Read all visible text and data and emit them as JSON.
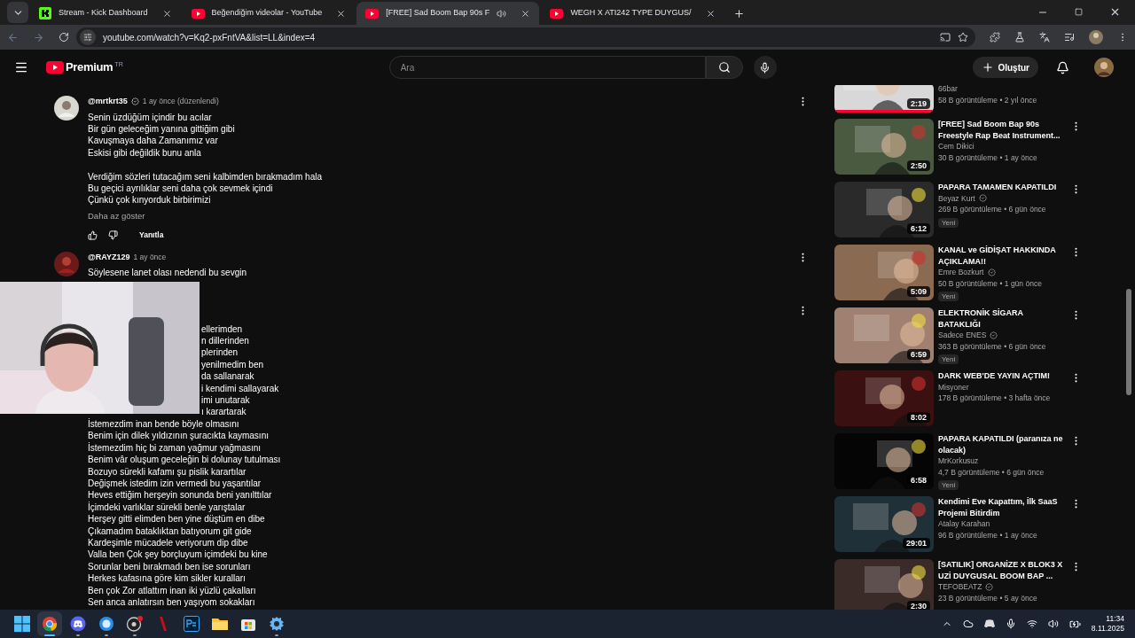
{
  "browser": {
    "tabs": [
      {
        "kind": "kick",
        "label": "Stream - Kick Dashboard",
        "selected": false,
        "playing": false
      },
      {
        "kind": "youtube",
        "label": "Beğendiğim videolar - YouTube",
        "selected": false,
        "playing": false
      },
      {
        "kind": "youtube",
        "label": "[FREE] Sad Boom Bap 90s F",
        "selected": true,
        "playing": true
      },
      {
        "kind": "youtube",
        "label": "WEGH X ATI242 TYPE DUYGUS/",
        "selected": false,
        "playing": false
      }
    ],
    "url": "youtube.com/watch?v=Kq2-pxFntVA&list=LL&index=4"
  },
  "header": {
    "logo": "Premium",
    "region": "TR",
    "search": {
      "placeholder": "Ara"
    },
    "create": "Oluştur"
  },
  "comments": [
    {
      "author": "@mrtkrt35",
      "verified": true,
      "time": "1 ay önce (düzenlendi)",
      "paragraphs": [
        [
          "Senin üzdüğüm içindir bu acılar",
          "Bir gün geleceğim yanına gittiğim gibi",
          "Kavuşmaya daha Zamanımız var",
          "Eskisi gibi değildik bunu anla"
        ],
        [
          "Verdiğim sözleri tutacağım seni kalbimden bırakmadım hala",
          "Bu geçici ayrılıklar seni daha çok sevmek içindi",
          "Çünkü çok kınyorduk birbirimizi"
        ]
      ],
      "toggle": "Daha az göster",
      "reply": "Yanıtla"
    },
    {
      "author": "@RAYZ129",
      "verified": false,
      "time": "1 ay önce",
      "paragraphs": [
        [
          "Söylesene lanet olası nedendi bu sevgin"
        ]
      ],
      "hidden_lines": [
        "ellerimden",
        "n dillerinden",
        "plerinden",
        "yenilmedim ben",
        "da sallanarak",
        "i kendimi sallayarak",
        "imi unutarak",
        "ı karartarak"
      ],
      "more_lines": [
        "İstemezdim inan bende böyle olmasını",
        "Benim için dilek yıldızının şuracıkta kaymasını",
        "İstemezdim hiç bi zaman yağmur yağmasını",
        "Benim vâr oluşum geceleğin bi dolunay tutulması",
        "Bozuyo sürekli kafamı şu pislik karartılar",
        "Değişmek istedim izin vermedi bu yaşantılar",
        "Heves ettiğim herşeyin sonunda beni yanılttılar",
        "İçimdeki varlıklar sürekli benle yarıştalar",
        "Herşey gitti elimden ben yine düştüm en dibe",
        "Çıkamadım bataklıktan batıyorum git gide",
        "Kardeşimle mücadele veriyorum dip dibe",
        "Valla ben Çok şey borçluyum içimdeki bu kine",
        "Sorunlar beni bırakmadı ben ise sorunları",
        "Herkes kafasına göre kim sikler kuralları",
        "Ben çok Zor atlattım inan iki yüzlü çakalları",
        "Sen anca anlatırsın ben yaşıyom sokakları"
      ]
    }
  ],
  "sidebar": [
    {
      "channel": "66bar",
      "verified": false,
      "meta": "58 B görüntüleme • 2 yıl önce",
      "duration": "2:19",
      "level": 1
    },
    {
      "title": "[FREE] Sad Boom Bap 90s Freestyle Rap Beat Instrument...",
      "channel": "Cem Dikici",
      "verified": false,
      "meta": "30 B görüntüleme • 1 ay önce",
      "duration": "2:50"
    },
    {
      "title": "PAPARA TAMAMEN KAPATILDI",
      "channel": "Beyaz Kurt",
      "verified": true,
      "meta": "269 B görüntüleme • 6 gün önce",
      "duration": "6:12",
      "badge": "Yeni"
    },
    {
      "title": "KANAL ve GİDİŞAT HAKKINDA AÇIKLAMA!!",
      "channel": "Emre Bozkurt",
      "verified": true,
      "meta": "50 B görüntüleme • 1 gün önce",
      "duration": "5:09",
      "badge": "Yeni"
    },
    {
      "title": "ELEKTRONİK SİGARA BATAKLIĞI",
      "channel": "Sadece ENES",
      "verified": true,
      "meta": "363 B görüntüleme • 6 gün önce",
      "duration": "6:59",
      "badge": "Yeni"
    },
    {
      "title": "DARK WEB'DE YAYIN AÇTIM!",
      "channel": "Misyoner",
      "verified": false,
      "meta": "178 B görüntüleme • 3 hafta önce",
      "duration": "8:02"
    },
    {
      "title": "PAPARA KAPATILDI (paranıza ne olacak)",
      "channel": "MrKorkusuz",
      "verified": false,
      "meta": "4,7 B görüntüleme • 6 gün önce",
      "duration": "6:58",
      "badge": "Yeni"
    },
    {
      "title": "Kendimi Eve Kapattım, İlk SaaS Projemi Bitirdim",
      "channel": "Atalay Karahan",
      "verified": false,
      "meta": "96 B görüntüleme • 1 ay önce",
      "duration": "29:01"
    },
    {
      "title": "[SATILIK] ORGANİZE X BLOK3 X UZİ DUYGUSAL BOOM BAP ...",
      "channel": "TEFOBEATZ",
      "verified": true,
      "meta": "23 B görüntüleme • 5 ay önce",
      "duration": "2:30"
    }
  ],
  "taskbar": {
    "apps": [
      {
        "kind": "chrome",
        "running": true,
        "selected": true
      },
      {
        "kind": "discord",
        "running": true,
        "selected": false
      },
      {
        "kind": "orb",
        "running": true,
        "selected": false
      },
      {
        "kind": "obs",
        "running": true,
        "selected": false
      },
      {
        "kind": "slash",
        "running": false,
        "selected": false
      },
      {
        "kind": "ps",
        "running": false,
        "selected": false
      },
      {
        "kind": "folder",
        "running": false,
        "selected": false
      },
      {
        "kind": "store",
        "running": false,
        "selected": false
      },
      {
        "kind": "gear",
        "running": true,
        "selected": false
      }
    ],
    "time": "11:34",
    "date": "8.11.2025"
  }
}
